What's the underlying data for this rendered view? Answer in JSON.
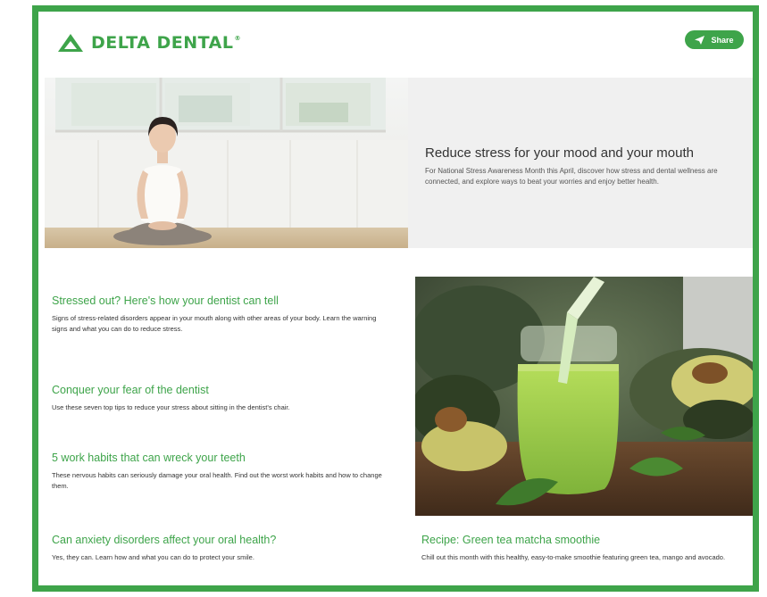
{
  "header": {
    "brand": "DELTA DENTAL",
    "brand_mark": "®",
    "share_label": "Share",
    "brand_color": "#3ea44a"
  },
  "hero": {
    "title": "Reduce stress for your mood and your mouth",
    "description": "For National Stress Awareness Month this April, discover how stress and dental wellness are connected, and explore ways to beat your worries and enjoy better health.",
    "image_icon": "meditation-photo"
  },
  "articles": [
    {
      "title": "Stressed out? Here's how your dentist can tell",
      "description": "Signs of stress-related disorders appear in your mouth along with other areas of your body. Learn the warning signs and what you can do to reduce stress."
    },
    {
      "title": "Conquer your fear of the dentist",
      "description": "Use these seven top tips to reduce your stress about sitting in the dentist's chair."
    },
    {
      "title": "5 work habits that can wreck your teeth",
      "description": "These nervous habits can seriously damage your oral health. Find out the worst work habits and how to change them."
    },
    {
      "title": "Can anxiety disorders affect your oral health?",
      "description": "Yes, they can. Learn how and what you can do to protect your smile."
    }
  ],
  "recipe": {
    "title": "Recipe: Green tea matcha smoothie",
    "description": "Chill out this month with this healthy, easy-to-make smoothie featuring green tea, mango and avocado.",
    "image_icon": "smoothie-photo"
  }
}
